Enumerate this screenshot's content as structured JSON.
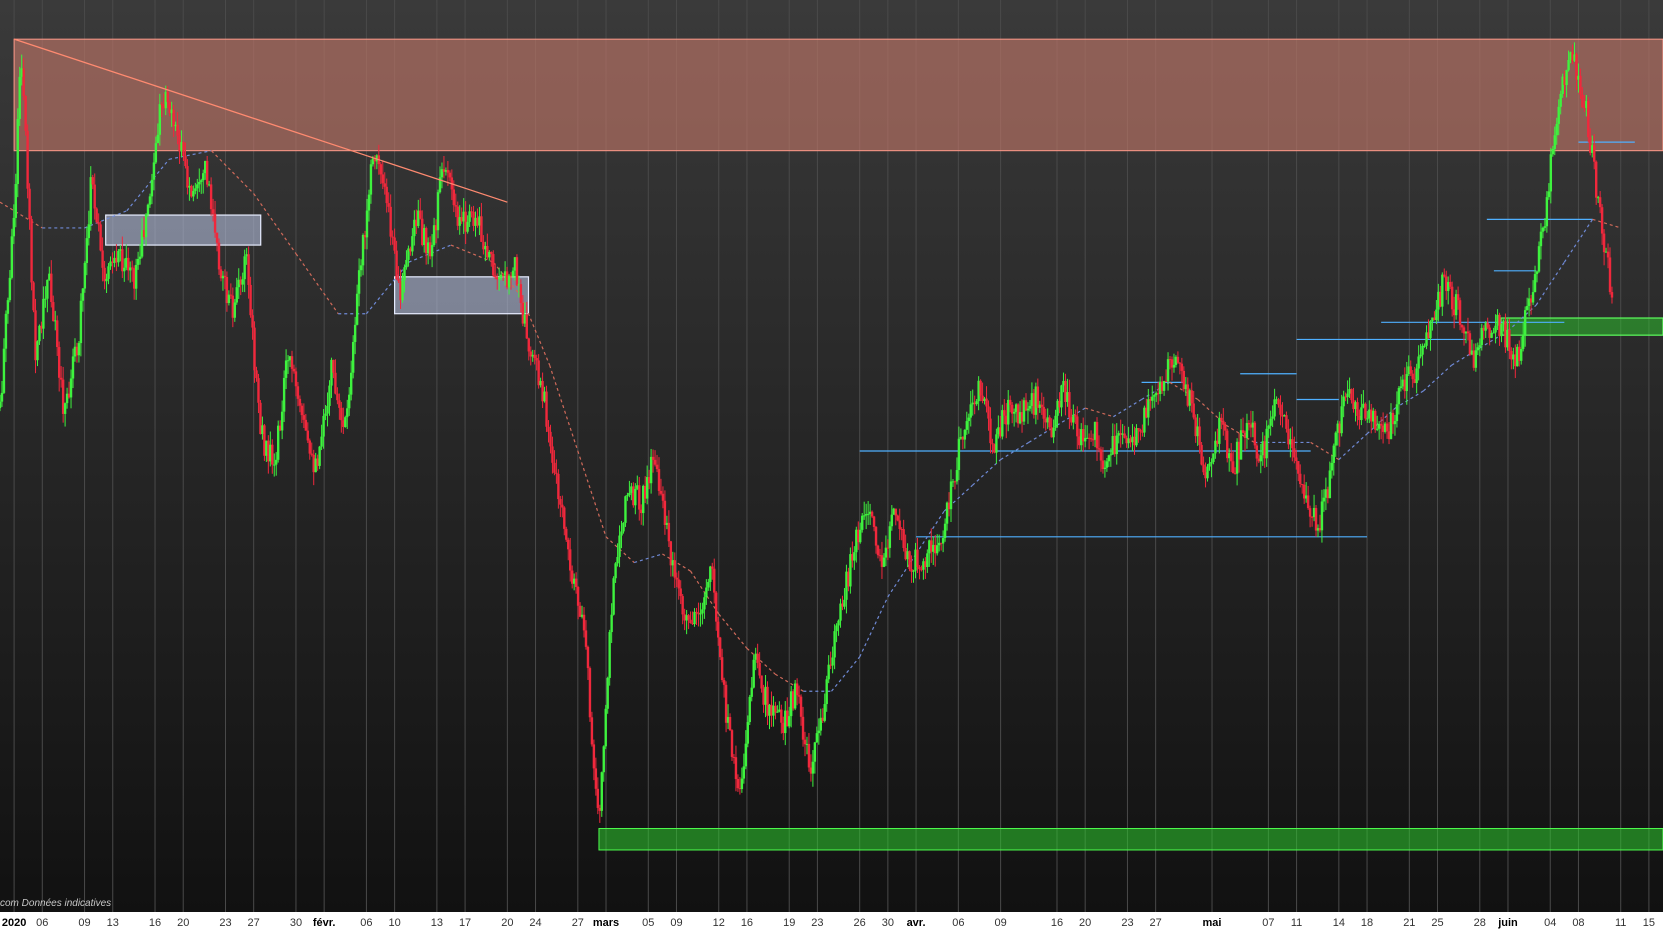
{
  "chart_data": {
    "type": "candlestick",
    "title": "",
    "note": "com  Données indicatives",
    "xlabel": "",
    "ylabel": "",
    "grid": true,
    "colors": {
      "background_top": "#3a3a3a",
      "background_bottom": "#111111",
      "grid": "#4a4a4a",
      "up": "#3ef23e",
      "down": "#f0283c",
      "resistance_zone": "#c87a6a",
      "support_zone": "#2ecc2e",
      "consolidation_box": "#b4bedc",
      "horizontal_levels": "#4fb0ff",
      "trendline": "#ff8a70",
      "moving_average_up": "#6f8ad6",
      "moving_average_down": "#d06a5a"
    },
    "x_tick_labels": [
      {
        "label": "2020",
        "day": 0,
        "month": true
      },
      {
        "label": "06",
        "day": 2
      },
      {
        "label": "09",
        "day": 5
      },
      {
        "label": "13",
        "day": 7
      },
      {
        "label": "16",
        "day": 10
      },
      {
        "label": "20",
        "day": 12
      },
      {
        "label": "23",
        "day": 15
      },
      {
        "label": "27",
        "day": 17
      },
      {
        "label": "30",
        "day": 20
      },
      {
        "label": "févr.",
        "day": 22,
        "month": true
      },
      {
        "label": "06",
        "day": 25
      },
      {
        "label": "10",
        "day": 27
      },
      {
        "label": "13",
        "day": 30
      },
      {
        "label": "17",
        "day": 32
      },
      {
        "label": "20",
        "day": 35
      },
      {
        "label": "24",
        "day": 37
      },
      {
        "label": "27",
        "day": 40
      },
      {
        "label": "mars",
        "day": 42,
        "month": true
      },
      {
        "label": "05",
        "day": 45
      },
      {
        "label": "09",
        "day": 47
      },
      {
        "label": "12",
        "day": 50
      },
      {
        "label": "16",
        "day": 52
      },
      {
        "label": "19",
        "day": 55
      },
      {
        "label": "23",
        "day": 57
      },
      {
        "label": "26",
        "day": 60
      },
      {
        "label": "30",
        "day": 62
      },
      {
        "label": "avr.",
        "day": 64,
        "month": true
      },
      {
        "label": "06",
        "day": 67
      },
      {
        "label": "09",
        "day": 70
      },
      {
        "label": "16",
        "day": 74
      },
      {
        "label": "20",
        "day": 76
      },
      {
        "label": "23",
        "day": 79
      },
      {
        "label": "27",
        "day": 81
      },
      {
        "label": "mai",
        "day": 85,
        "month": true
      },
      {
        "label": "07",
        "day": 89
      },
      {
        "label": "11",
        "day": 91
      },
      {
        "label": "14",
        "day": 94
      },
      {
        "label": "18",
        "day": 96
      },
      {
        "label": "21",
        "day": 99
      },
      {
        "label": "25",
        "day": 101
      },
      {
        "label": "28",
        "day": 104
      },
      {
        "label": "juin",
        "day": 106,
        "month": true
      },
      {
        "label": "04",
        "day": 109
      },
      {
        "label": "08",
        "day": 111
      },
      {
        "label": "11",
        "day": 114
      },
      {
        "label": "15",
        "day": 116
      }
    ],
    "x_range": [
      -1,
      117
    ],
    "y_range": [
      0,
      100
    ],
    "price_path": [
      [
        -1,
        55
      ],
      [
        0,
        78
      ],
      [
        0.5,
        97
      ],
      [
        1.5,
        62
      ],
      [
        2.5,
        70
      ],
      [
        3.5,
        55
      ],
      [
        4.5,
        62
      ],
      [
        5.5,
        82
      ],
      [
        6.5,
        70
      ],
      [
        7.5,
        73
      ],
      [
        8.5,
        70
      ],
      [
        9.5,
        78
      ],
      [
        10.5,
        92
      ],
      [
        11.5,
        88
      ],
      [
        12.5,
        80
      ],
      [
        13.5,
        84
      ],
      [
        14.5,
        72
      ],
      [
        15.5,
        66
      ],
      [
        16.5,
        72
      ],
      [
        17.5,
        52
      ],
      [
        18.5,
        48
      ],
      [
        19.5,
        62
      ],
      [
        20.5,
        55
      ],
      [
        21.5,
        47
      ],
      [
        22.5,
        60
      ],
      [
        23.5,
        53
      ],
      [
        24.5,
        70
      ],
      [
        25.5,
        86
      ],
      [
        26.5,
        78
      ],
      [
        27.5,
        68
      ],
      [
        28.5,
        78
      ],
      [
        29.5,
        72
      ],
      [
        30.5,
        84
      ],
      [
        31.5,
        76
      ],
      [
        32.5,
        78
      ],
      [
        33.5,
        74
      ],
      [
        34.5,
        69
      ],
      [
        35.5,
        72
      ],
      [
        36.5,
        62
      ],
      [
        37.5,
        57
      ],
      [
        38.5,
        46
      ],
      [
        39.5,
        37
      ],
      [
        40.5,
        28
      ],
      [
        41.5,
        6
      ],
      [
        42.5,
        35
      ],
      [
        43.5,
        46
      ],
      [
        44.5,
        44
      ],
      [
        45.5,
        50
      ],
      [
        46.5,
        38
      ],
      [
        47.5,
        30
      ],
      [
        48.5,
        30
      ],
      [
        49.5,
        36
      ],
      [
        50.5,
        20
      ],
      [
        51.5,
        10
      ],
      [
        52.5,
        26
      ],
      [
        53.5,
        20
      ],
      [
        54.5,
        18
      ],
      [
        55.5,
        22
      ],
      [
        56.5,
        12
      ],
      [
        57.5,
        21
      ],
      [
        58.5,
        30
      ],
      [
        59.5,
        38
      ],
      [
        60.5,
        44
      ],
      [
        61.5,
        36
      ],
      [
        62.5,
        44
      ],
      [
        63.5,
        36
      ],
      [
        64.5,
        38
      ],
      [
        65.5,
        38
      ],
      [
        66.5,
        45
      ],
      [
        67.5,
        54
      ],
      [
        68.5,
        57
      ],
      [
        69.5,
        51
      ],
      [
        70.5,
        55
      ],
      [
        71.5,
        54
      ],
      [
        72.5,
        56
      ],
      [
        73.5,
        52
      ],
      [
        74.5,
        57
      ],
      [
        75.5,
        52
      ],
      [
        76.5,
        53
      ],
      [
        77.5,
        48
      ],
      [
        78.5,
        53
      ],
      [
        79.5,
        51
      ],
      [
        80.5,
        55
      ],
      [
        81.5,
        58
      ],
      [
        82.5,
        62
      ],
      [
        83.5,
        55
      ],
      [
        84.5,
        48
      ],
      [
        85.5,
        53
      ],
      [
        86.5,
        48
      ],
      [
        87.5,
        54
      ],
      [
        88.5,
        49
      ],
      [
        89.5,
        56
      ],
      [
        90.5,
        51
      ],
      [
        91.5,
        46
      ],
      [
        92.5,
        41
      ],
      [
        93.5,
        48
      ],
      [
        94.5,
        58
      ],
      [
        95.5,
        55
      ],
      [
        96.5,
        54
      ],
      [
        97.5,
        52
      ],
      [
        98.5,
        58
      ],
      [
        99.5,
        59
      ],
      [
        100.5,
        64
      ],
      [
        101.5,
        70
      ],
      [
        102.5,
        66
      ],
      [
        103.5,
        61
      ],
      [
        104.5,
        64
      ],
      [
        105.5,
        65
      ],
      [
        106.5,
        60
      ],
      [
        107.5,
        67
      ],
      [
        108.5,
        76
      ],
      [
        109.5,
        90
      ],
      [
        110.5,
        96
      ],
      [
        111.5,
        90
      ],
      [
        112.5,
        78
      ],
      [
        113.5,
        67
      ]
    ],
    "moving_average": [
      [
        -1,
        79
      ],
      [
        2,
        76
      ],
      [
        5,
        76
      ],
      [
        8,
        78
      ],
      [
        11,
        84
      ],
      [
        14,
        85
      ],
      [
        17,
        80
      ],
      [
        20,
        73
      ],
      [
        23,
        66
      ],
      [
        25,
        66
      ],
      [
        28,
        72
      ],
      [
        31,
        74
      ],
      [
        34,
        72
      ],
      [
        36,
        68
      ],
      [
        38,
        60
      ],
      [
        40,
        50
      ],
      [
        42,
        40
      ],
      [
        44,
        37
      ],
      [
        46,
        38
      ],
      [
        48,
        36
      ],
      [
        50,
        31
      ],
      [
        52,
        27
      ],
      [
        54,
        24
      ],
      [
        56,
        22
      ],
      [
        58,
        22
      ],
      [
        60,
        26
      ],
      [
        62,
        33
      ],
      [
        64,
        38
      ],
      [
        66,
        43
      ],
      [
        68,
        46
      ],
      [
        70,
        49
      ],
      [
        72,
        51
      ],
      [
        74,
        53
      ],
      [
        76,
        55
      ],
      [
        78,
        54
      ],
      [
        80,
        56
      ],
      [
        82,
        58
      ],
      [
        84,
        56
      ],
      [
        86,
        53
      ],
      [
        88,
        51
      ],
      [
        90,
        51
      ],
      [
        92,
        51
      ],
      [
        94,
        49
      ],
      [
        96,
        52
      ],
      [
        98,
        55
      ],
      [
        100,
        57
      ],
      [
        102,
        60
      ],
      [
        104,
        62
      ],
      [
        106,
        64
      ],
      [
        108,
        67
      ],
      [
        110,
        72
      ],
      [
        112,
        77
      ],
      [
        114,
        76
      ]
    ],
    "trendline": [
      [
        0,
        98
      ],
      [
        35,
        79
      ]
    ],
    "zones": [
      {
        "name": "resistance",
        "x": [
          0,
          117
        ],
        "y": [
          85,
          98
        ]
      },
      {
        "name": "support",
        "x": [
          41.5,
          117
        ],
        "y": [
          3.5,
          6
        ]
      }
    ],
    "boxes": [
      {
        "name": "consolidation-1",
        "x": [
          6.5,
          17.5
        ],
        "y": [
          74,
          77.5
        ]
      },
      {
        "name": "consolidation-2",
        "x": [
          27,
          36.5
        ],
        "y": [
          66,
          70.3
        ]
      },
      {
        "name": "support-juin",
        "x": [
          105.5,
          117
        ],
        "y": [
          63.5,
          65.5
        ]
      }
    ],
    "levels": [
      {
        "x": [
          60,
          92
        ],
        "y": 50
      },
      {
        "x": [
          64,
          96
        ],
        "y": 40
      },
      {
        "x": [
          80,
          83
        ],
        "y": 58
      },
      {
        "x": [
          87,
          91
        ],
        "y": 59
      },
      {
        "x": [
          91,
          94
        ],
        "y": 56
      },
      {
        "x": [
          91,
          103
        ],
        "y": 63
      },
      {
        "x": [
          97,
          110
        ],
        "y": 65
      },
      {
        "x": [
          104.5,
          112
        ],
        "y": 77
      },
      {
        "x": [
          105,
          108
        ],
        "y": 71
      },
      {
        "x": [
          111,
          115
        ],
        "y": 86
      }
    ]
  }
}
